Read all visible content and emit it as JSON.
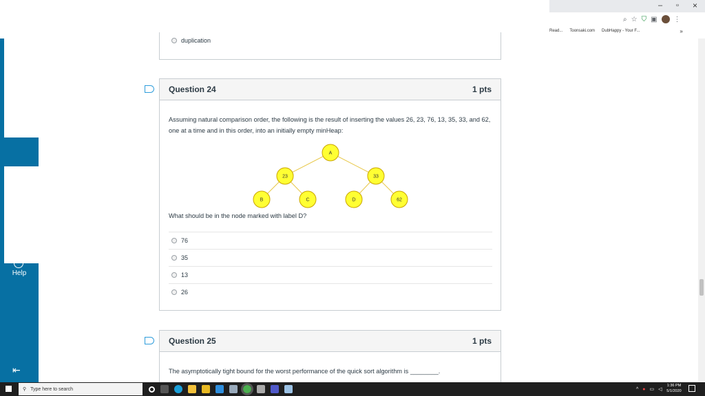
{
  "browser": {
    "window_controls": {
      "minimize": "–",
      "maximize": "▫",
      "close": "×"
    },
    "bookmarks": [
      "Read...",
      "Toonsaki.com",
      "DubHappy - Your F..."
    ],
    "bookmarks_overflow": "»"
  },
  "sidebar": {
    "help_label": "Help"
  },
  "previous_question": {
    "answer_label": "duplication"
  },
  "question24": {
    "title": "Question 24",
    "points": "1 pts",
    "prompt": "Assuming natural comparison order, the following is the result of inserting the values 26, 23, 76, 13, 35, 33, and 62, one at a time and in this order, into an initially empty minHeap:",
    "tree_nodes": [
      {
        "id": "root",
        "label": "A"
      },
      {
        "id": "left",
        "label": "23"
      },
      {
        "id": "right",
        "label": "33"
      },
      {
        "id": "ll",
        "label": "B"
      },
      {
        "id": "lr",
        "label": "C"
      },
      {
        "id": "rl",
        "label": "D"
      },
      {
        "id": "rr",
        "label": "62"
      }
    ],
    "node_fill": "#ffff33",
    "edge_color": "#e8c84a",
    "sub_question": "What should be in the node marked with label D?",
    "answers": [
      "76",
      "35",
      "13",
      "26"
    ]
  },
  "question25": {
    "title": "Question 25",
    "points": "1 pts",
    "prompt": "The asymptotically tight bound for the worst performance of the quick sort algorithm is ________."
  },
  "taskbar": {
    "search_placeholder": "Type here to search",
    "clock_time": "1:36 PM",
    "clock_date": "5/1/2020"
  },
  "colors": {
    "nav": "#0770a3",
    "flag": "#2d9cdb",
    "taskbar": "#1f1f1f"
  }
}
